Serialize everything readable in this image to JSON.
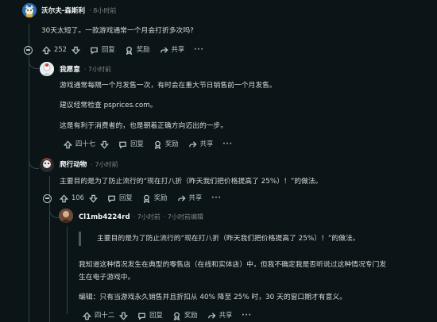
{
  "comments": [
    {
      "username": "沃尔夫-森斯利",
      "time": "· 8小时前",
      "text": [
        "30天太短了。一款游戏通常一个月会打折多次吗?"
      ],
      "upvotes": "252",
      "reply": "回复",
      "award": "奖励",
      "share": "共享"
    },
    {
      "username": "我愿意",
      "time": "· 7小时前",
      "text": [
        "游戏通常每隔一个月发售一次，有时会在重大节日销售前一个月发售。",
        "建议经常检查 psprices.com。",
        "这是有利于消费者的，也是朝着正确方向迈出的一步。"
      ],
      "upvotes": "四十七",
      "reply": "回复",
      "award": "奖励",
      "share": "共享"
    },
    {
      "username": "爬行动物",
      "time": "· 7小时前",
      "text": [
        "主要目的是为了防止流行的“现在打八折（昨天我们把价格提高了 25%）！”的做法。"
      ],
      "upvotes": "106",
      "reply": "回复",
      "award": "奖励",
      "share": "共享"
    },
    {
      "username": "Cl1mb4224rd",
      "time": "· 7小时前",
      "edited": "· 7小时前编辑",
      "quote": "主要目的是为了防止流行的“现在打八折（昨天我们把价格提高了 25%）！”的做法。",
      "text": [
        "我知道这种情况发生在典型的零售店（在线和实体店）中，但我不确定我是否听说过这种情况专门发",
        "生在电子游戏中。",
        "编辑：只有当游戏永久销售并且折扣从 40% 降至 25% 时，30 天的窗口期才有意义。"
      ],
      "upvotes": "四十二",
      "reply": "回复",
      "award": "奖励",
      "share": "共享"
    }
  ],
  "colors": {
    "background": "#0b1416",
    "text": "#d7dadc",
    "meta": "#818384",
    "thread_line": "#33464c"
  },
  "icons": [
    "upvote-icon",
    "downvote-icon",
    "reply-icon",
    "award-icon",
    "share-icon",
    "more-icon",
    "collapse-icon"
  ]
}
